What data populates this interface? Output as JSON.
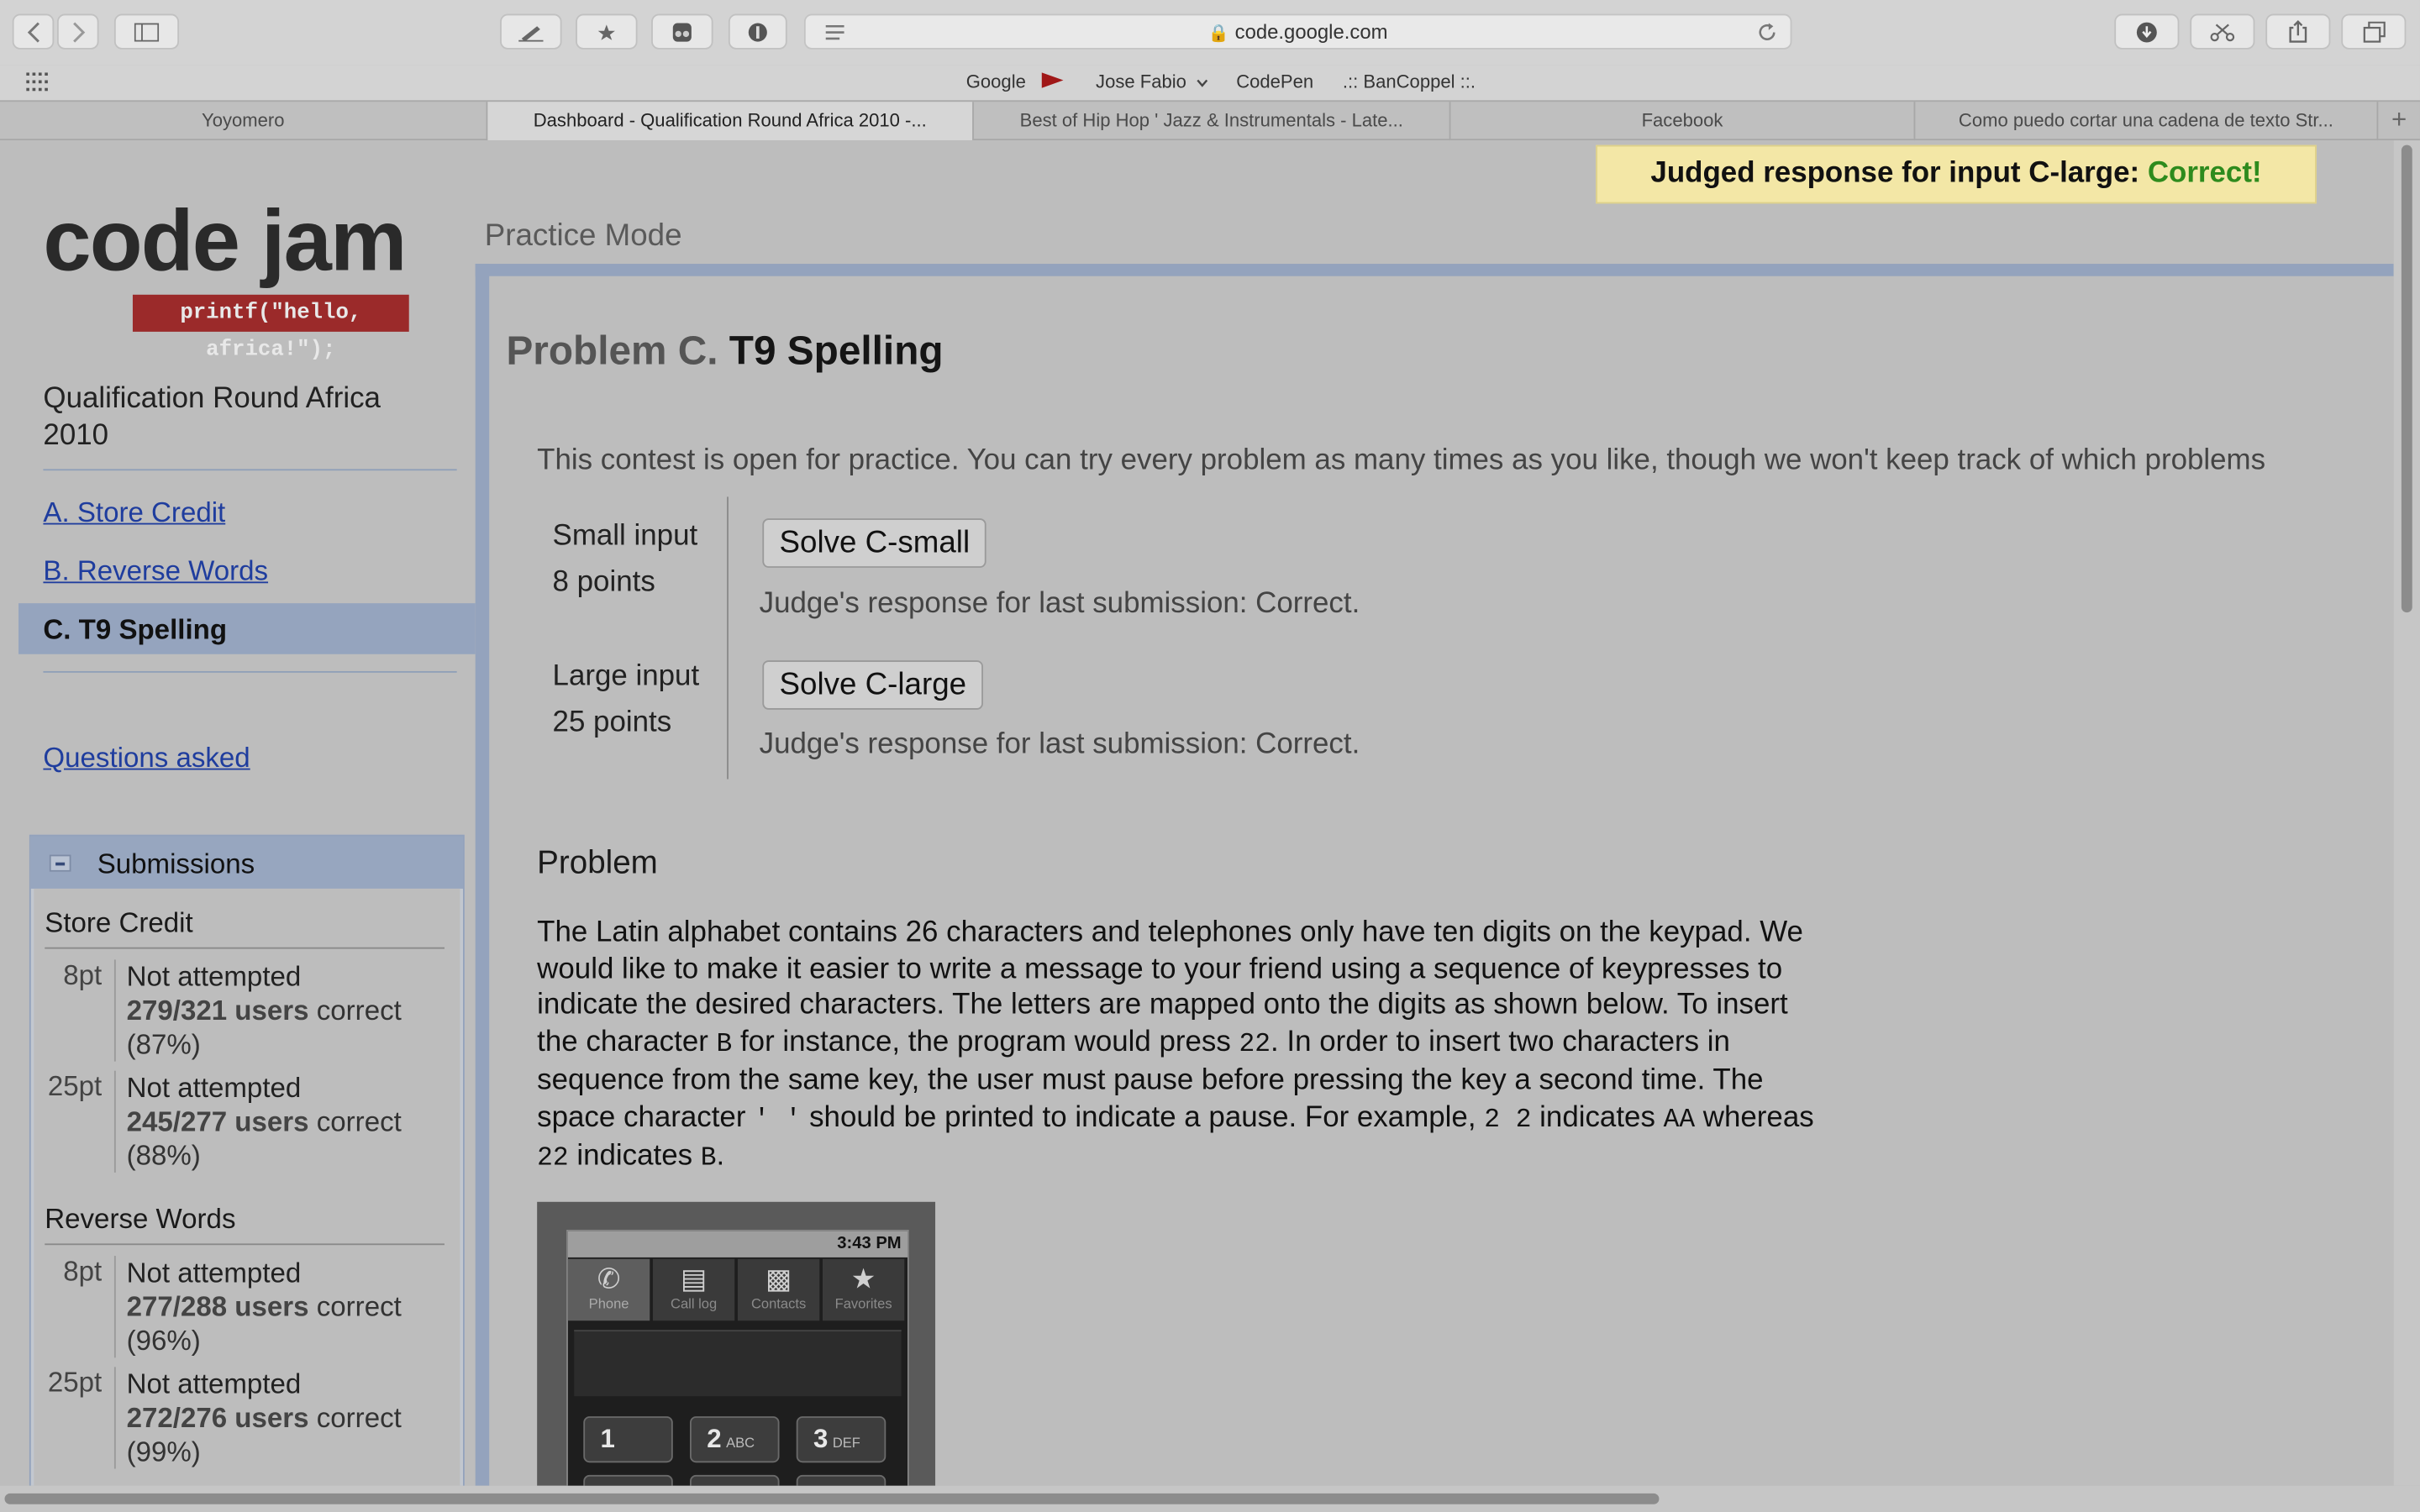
{
  "browser": {
    "url": "code.google.com",
    "bookmarks": [
      "Google",
      "Jose Fabio",
      "CodePen",
      ".:: BanCoppel ::."
    ],
    "tabs": [
      "Yoyomero",
      "Dashboard - Qualification Round Africa 2010 -...",
      "Best of Hip Hop ' Jazz & Instrumentals - Late...",
      "Facebook",
      "Como puedo cortar una cadena de texto Str..."
    ],
    "new_tab": "+"
  },
  "banner": {
    "prefix": "Judged response for input C-large:",
    "result": "Correct!"
  },
  "logo": {
    "text": "code jam",
    "tag": "printf(\"hello, africa!\");"
  },
  "sidebar": {
    "round_title": "Qualification Round Africa 2010",
    "problems": [
      "A. Store Credit",
      "B. Reverse Words",
      "C. T9 Spelling"
    ],
    "questions": "Questions asked",
    "submissions": {
      "title": "Submissions",
      "groups": [
        {
          "name": "Store Credit",
          "rows": [
            {
              "pts": "8pt",
              "status": "Not attempted",
              "count": "279/321 users",
              "word": "correct",
              "pct": "(87%)"
            },
            {
              "pts": "25pt",
              "status": "Not attempted",
              "count": "245/277 users",
              "word": "correct",
              "pct": "(88%)"
            }
          ]
        },
        {
          "name": "Reverse Words",
          "rows": [
            {
              "pts": "8pt",
              "status": "Not attempted",
              "count": "277/288 users",
              "word": "correct",
              "pct": "(96%)"
            },
            {
              "pts": "25pt",
              "status": "Not attempted",
              "count": "272/276 users",
              "word": "correct",
              "pct": "(99%)"
            }
          ]
        }
      ]
    }
  },
  "main": {
    "mode": "Practice Mode",
    "problem_prefix": "Problem C.",
    "problem_name": "T9 Spelling",
    "intro": "This contest is open for practice. You can try every problem as many times as you like, though we won't keep track of which problems",
    "inputs": [
      {
        "label": "Small input",
        "points": "8 points",
        "button": "Solve C-small",
        "judge": "Judge's response for last submission: Correct."
      },
      {
        "label": "Large input",
        "points": "25 points",
        "button": "Solve C-large",
        "judge": "Judge's response for last submission: Correct."
      }
    ],
    "section": "Problem",
    "para": {
      "t1": "The Latin alphabet contains 26 characters and telephones only have ten digits on the keypad. We would like to make it easier to write a message to your friend using a sequence of keypresses to indicate the desired characters. The letters are mapped onto the digits as shown below. To insert the character ",
      "c1": "B",
      "t2": " for instance, the program would press ",
      "c2": "22",
      "t3": ". In order to insert two characters in sequence from the same key, the user must pause before pressing the key a second time. The space character ",
      "c3": "' '",
      "t4": " should be printed to indicate a pause. For example, ",
      "c4": "2 2",
      "t5": " indicates ",
      "c5": "AA",
      "t6": " whereas ",
      "c6": "22",
      "t7": " indicates ",
      "c7": "B",
      "t8": "."
    },
    "phone": {
      "time": "3:43 PM",
      "tabs": [
        "Phone",
        "Call log",
        "Contacts",
        "Favorites"
      ],
      "keys": [
        {
          "num": "1",
          "letters": ""
        },
        {
          "num": "2",
          "letters": "ABC"
        },
        {
          "num": "3",
          "letters": "DEF"
        }
      ]
    }
  }
}
